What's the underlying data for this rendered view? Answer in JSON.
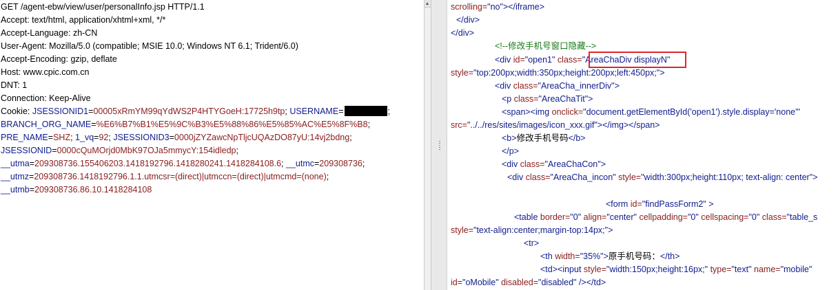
{
  "request": {
    "request_line": "GET /agent-ebw/view/user/personalInfo.jsp HTTP/1.1",
    "headers": [
      "Accept: text/html, application/xhtml+xml, */*",
      "Accept-Language: zh-CN",
      "User-Agent: Mozilla/5.0 (compatible; MSIE 10.0; Windows NT 6.1; Trident/6.0)",
      "Accept-Encoding: gzip, deflate",
      "Host: www.cpic.com.cn",
      "DNT: 1",
      "Connection: Keep-Alive"
    ],
    "cookie": {
      "label": "Cookie: ",
      "l1_n1": "JSESSIONID1",
      "l1_v1": "00005xRmYM99qYdWS2P4HTYGoeH:17725h9tp",
      "l1_n2": "USERNAME",
      "l2_n1": "BRANCH_ORG_NAME",
      "l2_v1": "%E6%B7%B1%E5%9C%B3%E5%88%86%E5%85%AC%E5%8F%B8",
      "l3_n1": "PRE_NAME",
      "l3_v1": "SHZ",
      "l3_n2": "1_vq",
      "l3_v2": "92",
      "l3_n3": "JSESSIONID3",
      "l3_v3": "0000jZYZawcNpTljcUQAzDO87yU:14vj2bdng",
      "l4_n1": "JSESSIONID",
      "l4_v1": "0000cQuMOrjd0MbK97OJa5mmycY:154idledp",
      "l5_n1": "__utma",
      "l5_v1": "209308736.155406203.1418192796.1418280241.1418284108.6",
      "l5_n2": "__utmc",
      "l5_v2": "209308736",
      "l6_n1": "__utmz",
      "l6_v1": "209308736.1418192796.1.1.utmcsr=(direct)|utmccn=(direct)|utmcmd=(none)",
      "l7_n1": "__utmb",
      "l7_v1": "209308736.86.10.1418284108"
    }
  },
  "source": {
    "l1": {
      "a": "scrolling=",
      "b": "\"no\"",
      "c": "></iframe>"
    },
    "l2": {
      "a": "</div>"
    },
    "l3": {
      "a": "</div>"
    },
    "l4": {
      "a": "<!--修改手机号窗口隐藏-->"
    },
    "l5": {
      "a": "<div ",
      "b": "id=",
      "c": "\"open1\"",
      "d": " class=",
      "e": "\"AreaChaDiv displayN\""
    },
    "l6": {
      "a": "style=",
      "b": "\"top:200px;width:350px;height:200px;left:450px;\"",
      "c": ">"
    },
    "l7": {
      "a": "<div ",
      "b": "class=",
      "c": "\"AreaCha_innerDiv\"",
      "d": ">"
    },
    "l8": {
      "a": "<p ",
      "b": "class=",
      "c": "\"AreaChaTit\"",
      "d": ">"
    },
    "l9": {
      "a": "<span><img ",
      "b": "onclick=",
      "c": "\"document.getElementById('open1').style.display='none'\""
    },
    "l10": {
      "a": "src=",
      "b": "\"../../res/sites/images/icon_xxx.gif\"",
      "c": "></img></span>"
    },
    "l11": {
      "a": "<b>",
      "b": "修改手机号码",
      "c": "</b>"
    },
    "l12": {
      "a": "</p>"
    },
    "l13": {
      "a": "<div ",
      "b": "class=",
      "c": "\"AreaChaCon\"",
      "d": ">"
    },
    "l14": {
      "a": "<div ",
      "b": "class=",
      "c": "\"AreaCha_incon\"",
      "d": " style=",
      "e": "\"width:300px;height:110px; text-align: center\"",
      "f": ">"
    },
    "l15": {
      "a": "<form ",
      "b": "id=",
      "c": "\"findPassForm2\"",
      "d": " >"
    },
    "l16": {
      "a": "<table  ",
      "b": "border=",
      "c": "\"0\"",
      "d": " align=",
      "e": "\"center\"",
      "f": " cellpadding=",
      "g": "\"0\"",
      "h": "  cellspacing=",
      "i": "\"0\"",
      "j": " class=",
      "k": "\"table_s"
    },
    "l17": {
      "a": "style=",
      "b": "\"text-align:center;margin-top:14px;\"",
      "c": ">"
    },
    "l18": {
      "a": "<tr>"
    },
    "l19": {
      "a": "<th ",
      "b": "width=",
      "c": "\"35%\"",
      "d": ">",
      "e": "原手机号码：",
      "f": "</th>"
    },
    "l20": {
      "a": "<td><input ",
      "b": "style=",
      "c": "\"width:150px;height:16px;\"",
      "d": "   type=",
      "e": "\"text\"",
      "f": " name=",
      "g": "\"mobile\""
    },
    "l21": {
      "a": "id=",
      "b": "\"oMobile\"",
      "c": " disabled=",
      "d": "\"disabled\"",
      "e": " /></td>"
    }
  },
  "colors": {
    "tag": "#0f1c8c",
    "attribute": "#8a1c1c",
    "comment": "#1a7a1a",
    "highlight": "#e0242b"
  }
}
